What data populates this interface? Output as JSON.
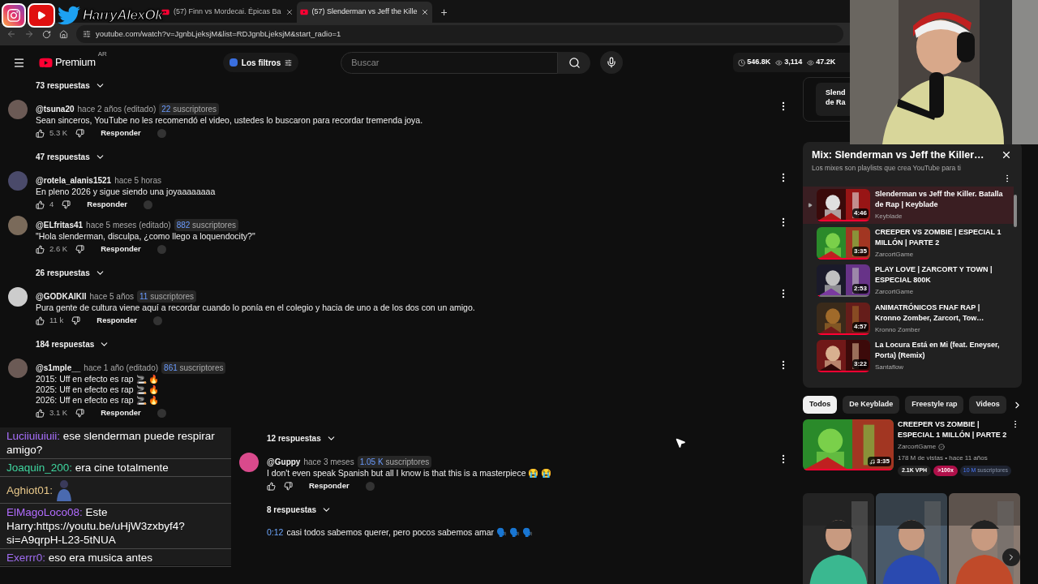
{
  "brand": {
    "name": "HarryAlexOk"
  },
  "browser": {
    "tabs": [
      {
        "title": "(57) Finn vs Mordecai. Épicas Ba",
        "selected": false
      },
      {
        "title": "(57) Slenderman vs Jeff the Kille",
        "selected": true
      }
    ],
    "new_tab": "+",
    "url": "youtube.com/watch?v=JgnbLjeksjM&list=RDJgnbLjeksjM&start_radio=1"
  },
  "header": {
    "logo": "Premium",
    "region": "AR",
    "filter": "Los filtros",
    "search": {
      "placeholder": "Buscar"
    },
    "stats": [
      "546.8K",
      "3,114",
      "47.2K"
    ]
  },
  "comments": [
    {
      "kind": "replies",
      "label": "73 respuestas"
    },
    {
      "kind": "comment",
      "author": "@tsuna20",
      "time": "hace 2 años (editado)",
      "subs_count": "22",
      "subs_label": "suscriptores",
      "lines": [
        "Sean sinceros, YouTube no les recomendó el video, ustedes lo buscaron para recordar tremenda joya."
      ],
      "likes": "5.3 K",
      "reply": "Responder"
    },
    {
      "kind": "replies",
      "label": "47 respuestas"
    },
    {
      "kind": "comment",
      "author": "@rotela_alanis1521",
      "time": "hace 5 horas",
      "lines": [
        "En pleno 2026 y sigue siendo una joyaaaaaaaa"
      ],
      "likes": "4",
      "reply": "Responder"
    },
    {
      "kind": "comment",
      "author": "@ELfritas41",
      "time": "hace 5 meses (editado)",
      "subs_count": "882",
      "subs_label": "suscriptores",
      "lines": [
        "\"Hola slenderman, disculpa, ¿como llego a loquendocity?\""
      ],
      "likes": "2.6 K",
      "reply": "Responder"
    },
    {
      "kind": "replies",
      "label": "26 respuestas"
    },
    {
      "kind": "comment",
      "author": "@GODKAIKII",
      "time": "hace 5 años",
      "subs_count": "11",
      "subs_label": "suscriptores",
      "lines": [
        "Pura gente de cultura viene aquí a recordar cuando lo ponía en el colegio y hacia de uno a de los dos con un amigo."
      ],
      "likes": "11 k",
      "reply": "Responder"
    },
    {
      "kind": "replies",
      "label": "184 respuestas"
    },
    {
      "kind": "comment",
      "author": "@s1mple__",
      "time": "hace 1 año (editado)",
      "subs_count": "861",
      "subs_label": "suscriptores",
      "lines": [
        "2015: Uff en efecto es rap 🚬 🔥",
        "2025: Uff en efecto es rap 🚬 🔥",
        "2026: Uff en efecto es rap 🚬 🔥"
      ],
      "likes": "3.1 K",
      "reply": "Responder"
    }
  ],
  "comments_beside_chat": [
    {
      "kind": "replies",
      "label": "12 respuestas"
    },
    {
      "kind": "comment",
      "author": "@Guppy",
      "time": "hace 3 meses",
      "subs_count": "1.05 K",
      "subs_label": "suscriptores",
      "lines": [
        "I don't even speak Spanish but all I know is that this is a masterpiece 😭 😭"
      ],
      "reply": "Responder"
    },
    {
      "kind": "replies",
      "label": "8 respuestas"
    },
    {
      "kind": "comment",
      "timestamp": "0:12",
      "lines": [
        "casi todos sabemos querer, pero pocos sabemos amar 🗣️ 🗣️ 🗣️"
      ]
    }
  ],
  "chat": [
    {
      "user": "Luciiuiuiuii:",
      "color": "#a970ff",
      "text": "ese slenderman puede respirar amigo?"
    },
    {
      "user": "Joaquin_200:",
      "color": "#3fd7a0",
      "text": "era cine totalmente"
    },
    {
      "user": "Aghiot01:",
      "color": "#e8c88a",
      "emote": true
    },
    {
      "user": "ElMagoLoco08:",
      "color": "#b26cff",
      "text": "Este Harry:https://youtu.be/uHjW3zxbyf4?si=A9qrpH-L23-5tNUA"
    },
    {
      "user": "Exerrr0:",
      "color": "#9f6cf0",
      "text": "eso era musica antes"
    }
  ],
  "sidebar": {
    "top_card": [
      "Slend",
      "de Ra"
    ],
    "playlist": {
      "title": "Mix: Slenderman vs Jeff the Killer…",
      "subtitle": "Los mixes son playlists que crea YouTube para ti",
      "items": [
        {
          "title": "Slenderman vs Jeff the Killer. Batalla de Rap | Keyblade",
          "channel": "Keyblade",
          "duration": "4:46",
          "selected": true,
          "level": 1
        },
        {
          "title": "CREEPER VS ZOMBIE | ESPECIAL 1 MILLÓN | PARTE 2",
          "channel": "ZarcortGame",
          "duration": "3:35",
          "selected": false,
          "level": 1
        },
        {
          "title": "PLAY LOVE | ZARCORT Y TOWN | ESPECIAL 800K",
          "channel": "ZarcortGame",
          "duration": "2:53",
          "selected": false,
          "level": 0.06
        },
        {
          "title": "ANIMATRÓNICOS FNAF RAP | Kronno Zomber, Zarcort, Tow…",
          "channel": "Kronno Zomber",
          "duration": "4:57",
          "selected": false,
          "level": 1
        },
        {
          "title": "La Locura Está en Mi (feat. Eneyser, Porta) (Remix)",
          "channel": "Santaflow",
          "duration": "3:22",
          "selected": false,
          "level": 1
        }
      ]
    },
    "chips": [
      {
        "label": "Todos",
        "selected": true
      },
      {
        "label": "De Keyblade",
        "selected": false
      },
      {
        "label": "Freestyle rap",
        "selected": false
      },
      {
        "label": "Videos",
        "selected": false
      }
    ],
    "video": {
      "title": "CREEPER VS ZOMBIE | ESPECIAL 1 MILLÓN | PARTE 2",
      "channel": "ZarcortGame",
      "meta": "178 M de vistas • hace 11 años",
      "duration": "3:35",
      "level": 1,
      "badges": [
        {
          "kind": "plain",
          "text": "2.1K VPH"
        },
        {
          "kind": "hot",
          "text": ">100x"
        },
        {
          "kind": "subs",
          "count": "10 M",
          "text": "suscriptores"
        }
      ]
    },
    "shorts": [
      {
        "kind": "picture"
      },
      {
        "kind": "picture"
      },
      {
        "kind": "picture"
      }
    ]
  }
}
